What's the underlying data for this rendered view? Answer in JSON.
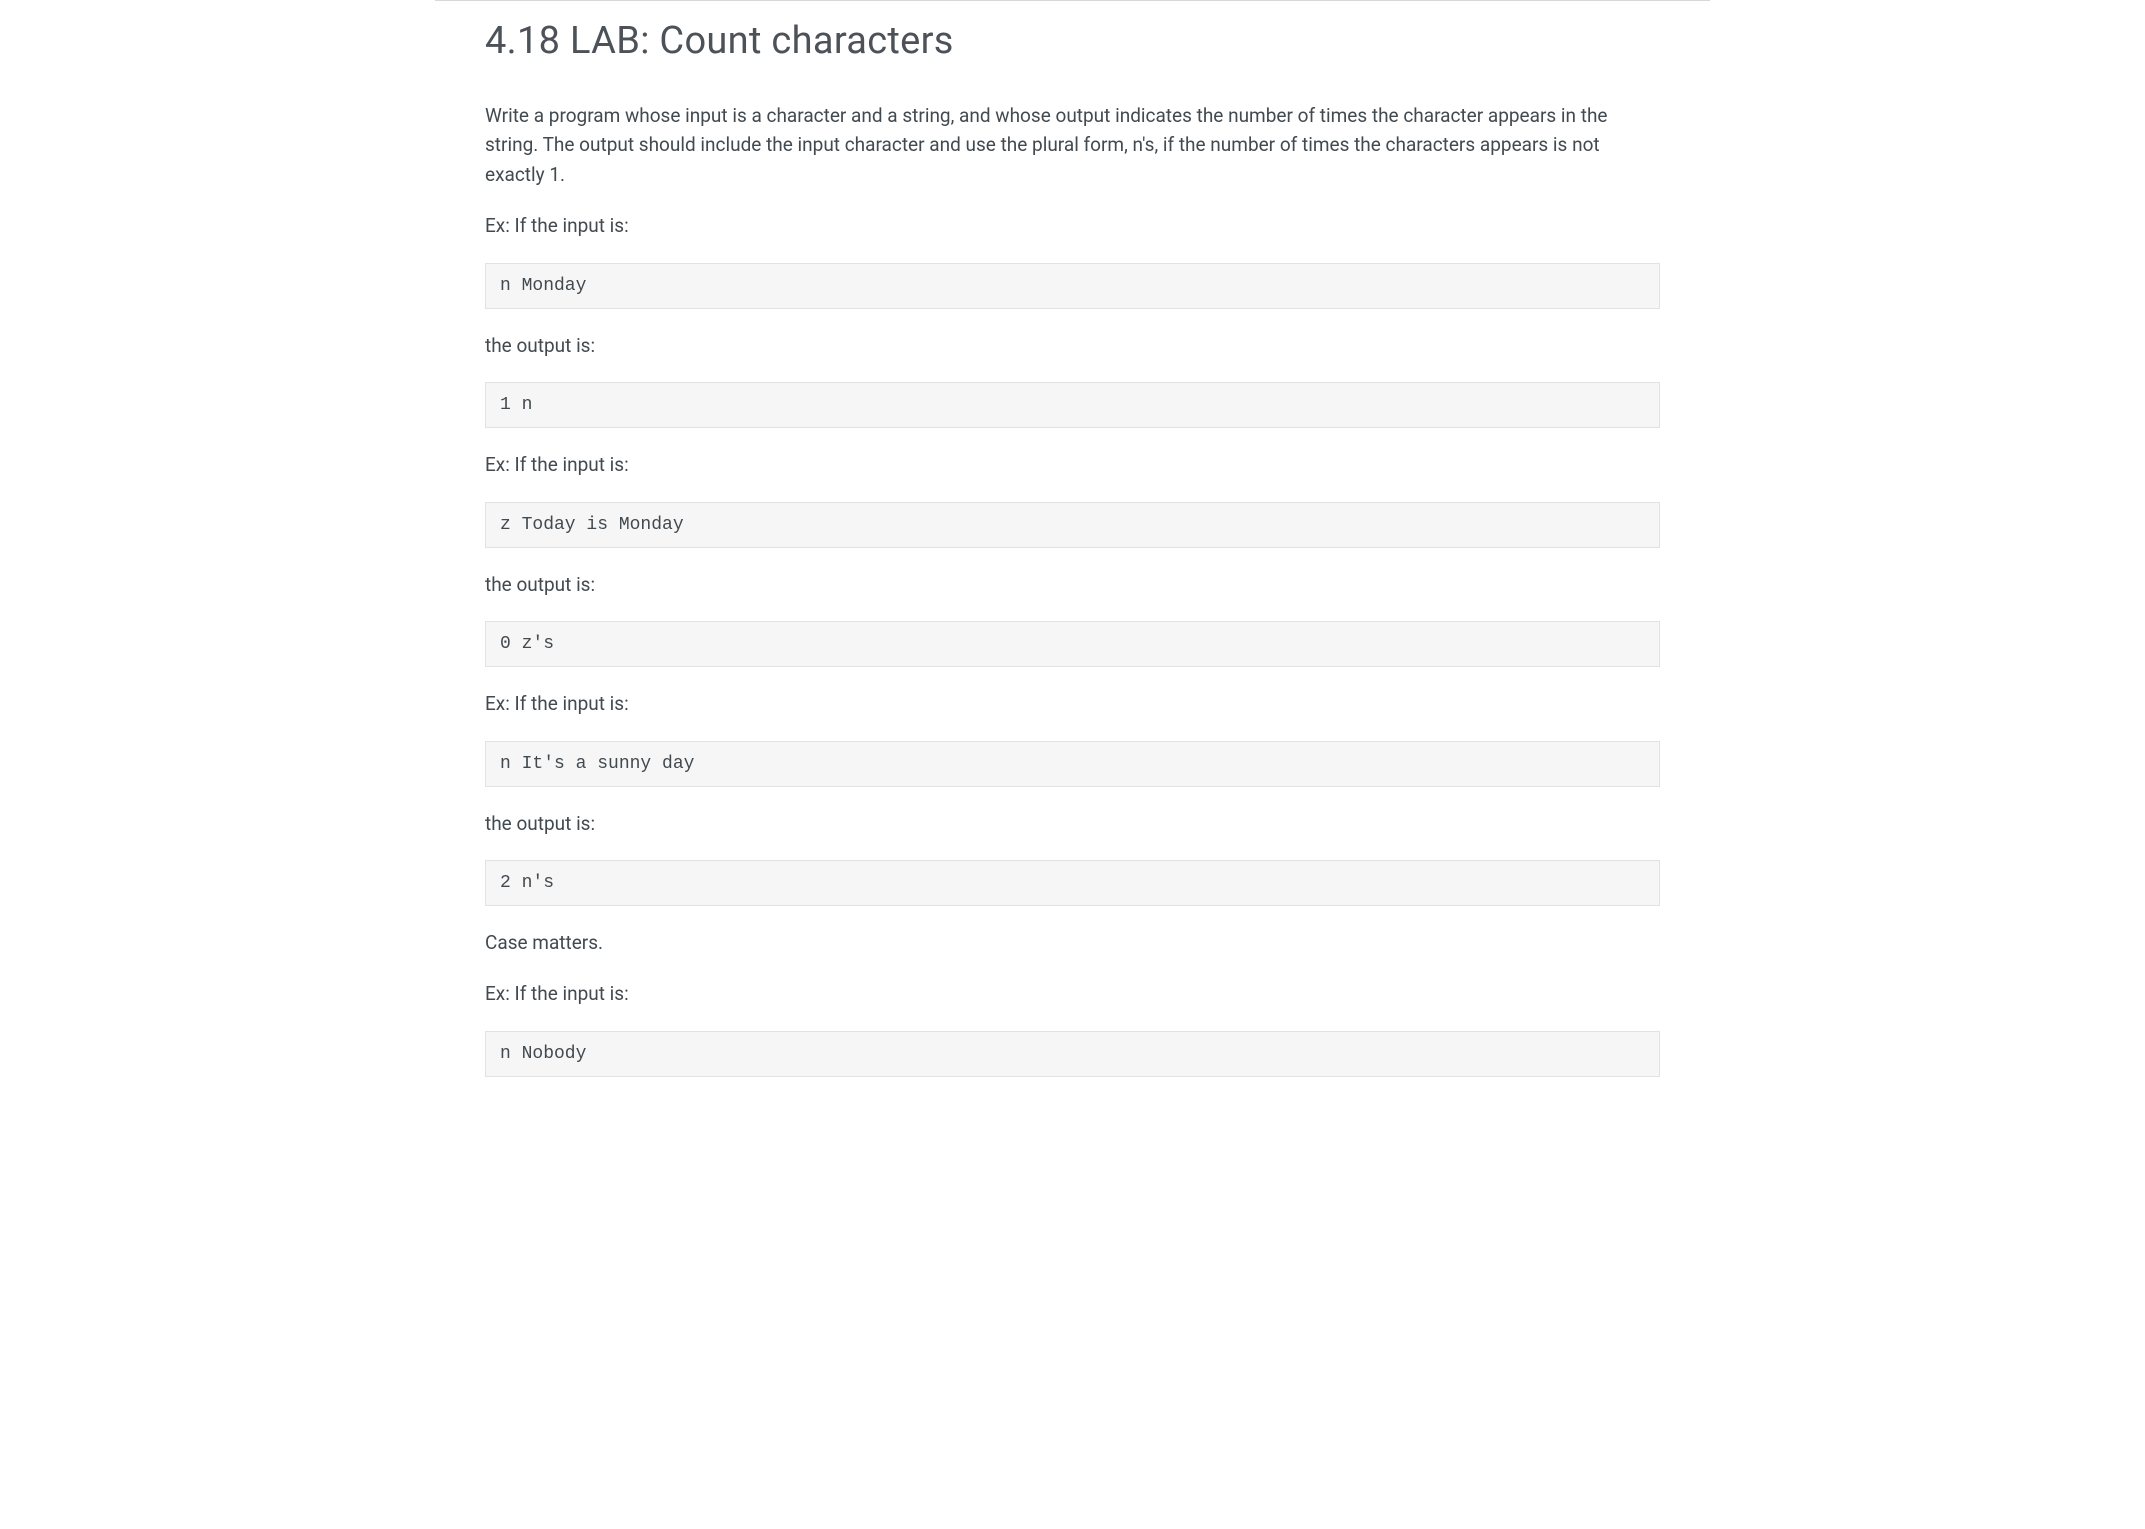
{
  "title": "4.18 LAB: Count characters",
  "intro": "Write a program whose input is a character and a string, and whose output indicates the number of times the character appears in the string. The output should include the input character and use the plural form, n's, if the number of times the characters appears is not exactly 1.",
  "examples": [
    {
      "input_label": "Ex: If the input is:",
      "input_code": "n Monday",
      "output_label": "the output is:",
      "output_code": "1 n"
    },
    {
      "input_label": "Ex: If the input is:",
      "input_code": "z Today is Monday",
      "output_label": "the output is:",
      "output_code": "0 z's"
    },
    {
      "input_label": "Ex: If the input is:",
      "input_code": "n It's a sunny day",
      "output_label": "the output is:",
      "output_code": "2 n's"
    }
  ],
  "case_note": "Case matters.",
  "final_example": {
    "input_label": "Ex: If the input is:",
    "input_code": "n Nobody"
  }
}
